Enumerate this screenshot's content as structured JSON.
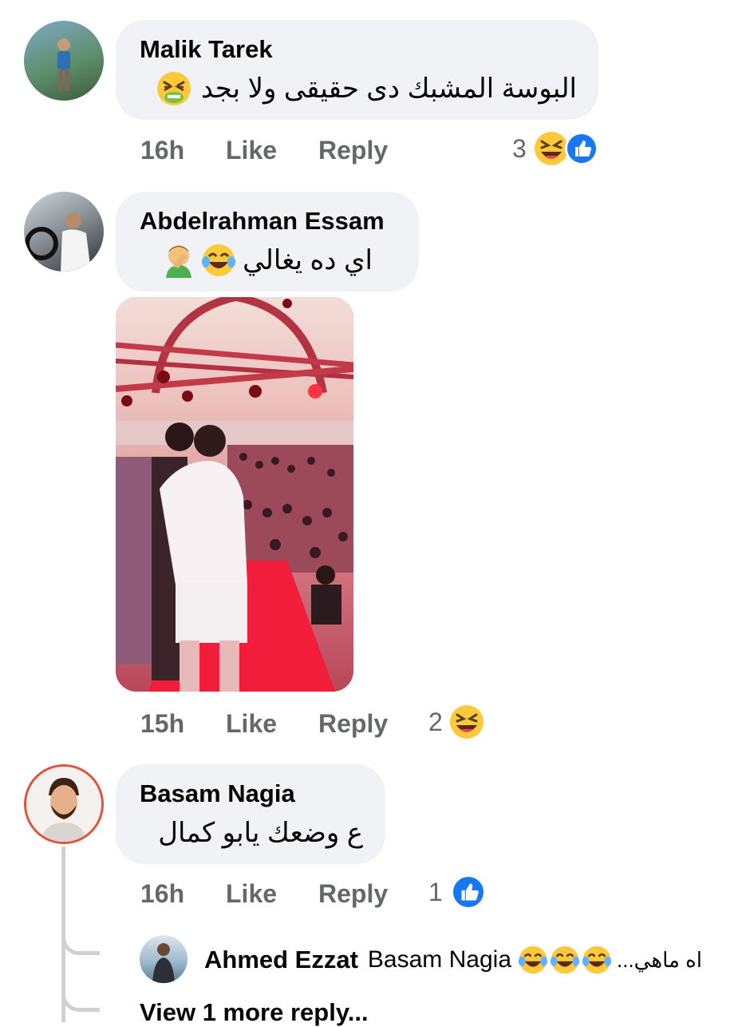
{
  "comments": [
    {
      "author": "Malik Tarek",
      "text": "البوسة المشبك دى حقيقى ولا بجد",
      "emoji": "nauseated-face",
      "time": "16h",
      "like_label": "Like",
      "reply_label": "Reply",
      "reaction_count": "3",
      "reactions": [
        "laughing-face",
        "like"
      ]
    },
    {
      "author": "Abdelrahman Essam",
      "text": "اي ده يغالي",
      "emoji": [
        "tears-of-joy-face",
        "facepalm"
      ],
      "attachment": "photo-concert-stage",
      "time": "15h",
      "like_label": "Like",
      "reply_label": "Reply",
      "reaction_count": "2",
      "reactions": [
        "laughing-face"
      ]
    },
    {
      "author": "Basam Nagia",
      "text": "ع وضعك يابو كمال",
      "time": "16h",
      "like_label": "Like",
      "reply_label": "Reply",
      "reaction_count": "1",
      "reactions": [
        "like"
      ]
    }
  ],
  "reply": {
    "author": "Ahmed Ezzat",
    "mention": "Basam Nagia",
    "text": "اه ماهي...",
    "emoji": [
      "tears-of-joy-face",
      "tears-of-joy-face",
      "tears-of-joy-face"
    ]
  },
  "view_more_label": "View 1 more reply...",
  "colors": {
    "bubble": "#f0f2f5",
    "meta_text": "#65676b",
    "like_blue": "#1877f2",
    "emoji_yellow": "#fcc93a"
  }
}
